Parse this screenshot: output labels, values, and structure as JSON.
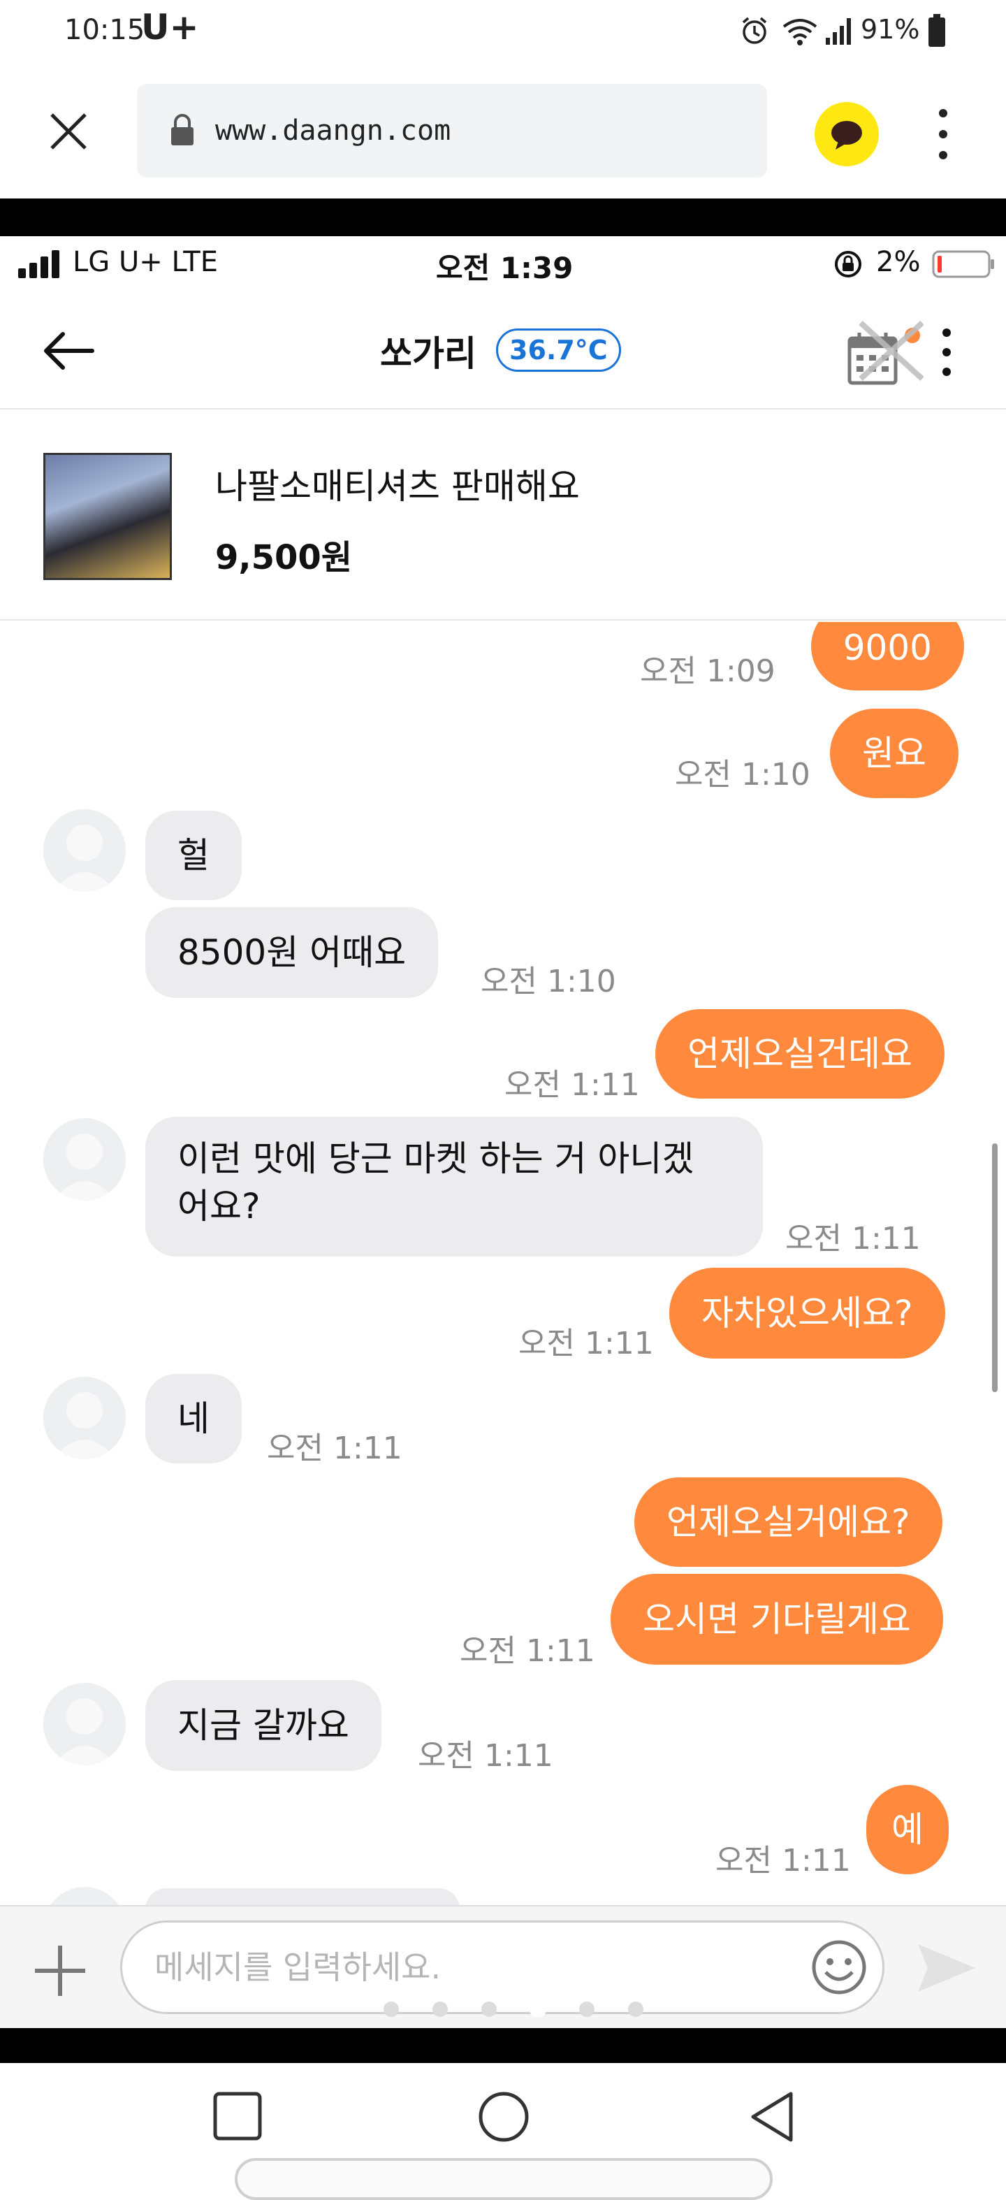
{
  "system_status": {
    "time": "10:15",
    "carrier": "U+",
    "battery": "91%"
  },
  "browser": {
    "url": "www.daangn.com"
  },
  "inner_status": {
    "carrier": "LG U+  LTE",
    "time": "오전 1:39",
    "battery": "2%"
  },
  "header": {
    "name": "쏘가리",
    "temperature": "36.7°C"
  },
  "product": {
    "title": "나팔소매티셔츠 판매해요",
    "price": "9,500원"
  },
  "messages": [
    {
      "side": "mine",
      "text": "9000",
      "time": "오전 1:09"
    },
    {
      "side": "mine",
      "text": "원요",
      "time": "오전 1:10"
    },
    {
      "side": "theirs",
      "text": "헐",
      "time": ""
    },
    {
      "side": "theirs",
      "text": "8500원 어때요",
      "time": "오전 1:10"
    },
    {
      "side": "mine",
      "text": "언제오실건데요",
      "time": "오전 1:11"
    },
    {
      "side": "theirs",
      "text": "이런 맛에 당근 마켓 하는 거 아니겠",
      "text2": "어요?",
      "time": "오전 1:11"
    },
    {
      "side": "mine",
      "text": "자차있으세요?",
      "time": "오전 1:11"
    },
    {
      "side": "theirs",
      "text": "네",
      "time": "오전 1:11"
    },
    {
      "side": "mine",
      "text": "언제오실거에요?",
      "time": ""
    },
    {
      "side": "mine",
      "text": "오시면 기다릴게요",
      "time": "오전 1:11"
    },
    {
      "side": "theirs",
      "text": "지금 갈까요",
      "time": "오전 1:11"
    },
    {
      "side": "mine",
      "text": "예",
      "time": "오전 1:11"
    }
  ],
  "input": {
    "placeholder": "메세지를 입력하세요."
  },
  "colors": {
    "accent": "#ff8a3d",
    "temperature": "#1a73d6",
    "bubble_theirs": "#ececee",
    "kakao": "#ffe812"
  },
  "icons": [
    "close-icon",
    "lock-icon",
    "kakao-chat-icon",
    "more-vertical-icon",
    "back-arrow-icon",
    "calendar-icon",
    "plus-icon",
    "emoji-icon",
    "send-icon",
    "recent-apps-icon",
    "home-icon",
    "back-icon"
  ]
}
